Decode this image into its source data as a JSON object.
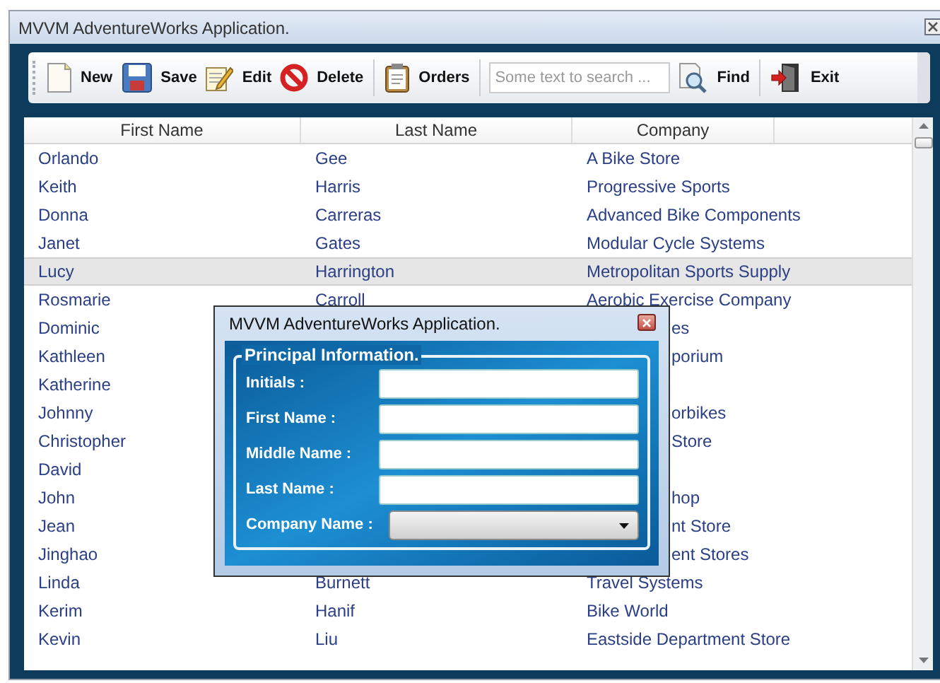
{
  "window": {
    "title": "MVVM AdventureWorks Application."
  },
  "toolbar": [
    {
      "kind": "new",
      "label": "New"
    },
    {
      "kind": "save",
      "label": "Save"
    },
    {
      "kind": "edit",
      "label": "Edit"
    },
    {
      "kind": "delete",
      "label": "Delete"
    },
    {
      "kind": "orders",
      "label": "Orders"
    },
    {
      "kind": "search",
      "placeholder": "Some text to search ..."
    },
    {
      "kind": "find",
      "label": "Find"
    },
    {
      "kind": "exit",
      "label": "Exit"
    }
  ],
  "table": {
    "columns": [
      "First Name",
      "Last Name",
      "Company"
    ],
    "rows": [
      {
        "first_name": "Orlando",
        "last_name": "Gee",
        "company": "A Bike Store",
        "selected": false
      },
      {
        "first_name": "Keith",
        "last_name": "Harris",
        "company": "Progressive Sports",
        "selected": false
      },
      {
        "first_name": "Donna",
        "last_name": "Carreras",
        "company": "Advanced Bike Components",
        "selected": false
      },
      {
        "first_name": "Janet",
        "last_name": "Gates",
        "company": "Modular Cycle Systems",
        "selected": false
      },
      {
        "first_name": "Lucy",
        "last_name": "Harrington",
        "company": "Metropolitan Sports Supply",
        "selected": true
      },
      {
        "first_name": "Rosmarie",
        "last_name": "Carroll",
        "company": "Aerobic Exercise Company",
        "selected": false
      },
      {
        "first_name": "Dominic",
        "company": "es",
        "selected": false
      },
      {
        "first_name": "Kathleen",
        "company": "porium",
        "selected": false
      },
      {
        "first_name": "Katherine",
        "selected": false
      },
      {
        "first_name": "Johnny",
        "company": "orbikes",
        "selected": false
      },
      {
        "first_name": "Christopher",
        "company": "Store",
        "selected": false
      },
      {
        "first_name": "David",
        "selected": false
      },
      {
        "first_name": "John",
        "company": "hop",
        "selected": false
      },
      {
        "first_name": "Jean",
        "company": "nt Store",
        "selected": false
      },
      {
        "first_name": "Jinghao",
        "company": "ent Stores",
        "selected": false
      },
      {
        "first_name": "Linda",
        "last_name": "Burnett",
        "company": "Travel Systems",
        "selected": false
      },
      {
        "first_name": "Kerim",
        "last_name": "Hanif",
        "company": "Bike World",
        "selected": false
      },
      {
        "first_name": "Kevin",
        "last_name": "Liu",
        "company": "Eastside Department Store",
        "selected": false
      }
    ]
  },
  "dialog": {
    "title": "MVVM AdventureWorks Application.",
    "group_title": "Principal Information.",
    "fields": [
      {
        "kind": "text",
        "label": "Initials :"
      },
      {
        "kind": "text",
        "label": "First Name :"
      },
      {
        "kind": "text",
        "label": "Middle Name :"
      },
      {
        "kind": "text",
        "label": "Last Name :"
      },
      {
        "kind": "dropdown",
        "label": "Company Name :"
      }
    ]
  }
}
